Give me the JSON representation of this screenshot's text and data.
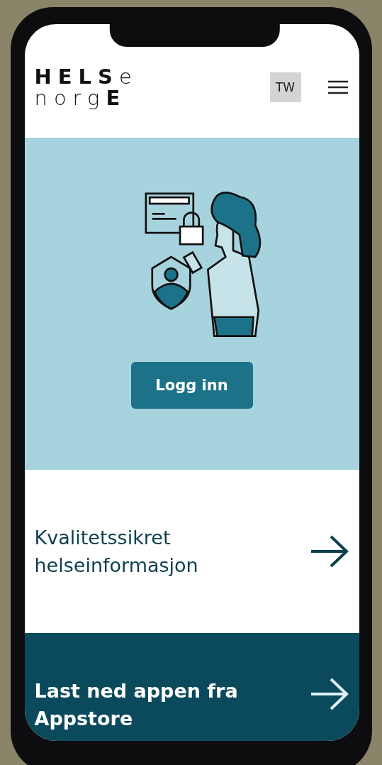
{
  "header": {
    "logo_lines": [
      "**HELS**e",
      "norg**E**"
    ],
    "avatar_initials": "TW"
  },
  "hero": {
    "button": "Logg inn"
  },
  "cards": [
    {
      "kind": "light",
      "title": "Kvalitetssikret helseinformasjon"
    },
    {
      "kind": "dark",
      "title": "Last ned appen fra Appstore"
    }
  ]
}
